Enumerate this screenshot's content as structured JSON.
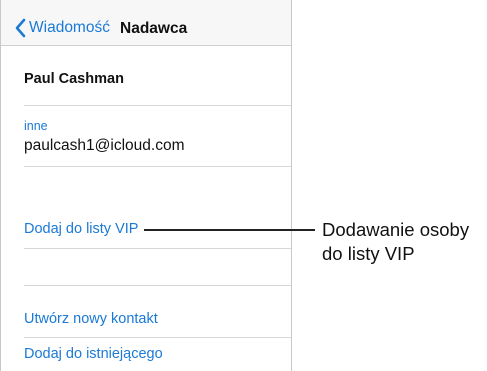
{
  "navbar": {
    "back_label": "Wiadomość",
    "title": "Nadawca"
  },
  "contact": {
    "name": "Paul Cashman",
    "email_label": "inne",
    "email": "paulcash1@icloud.com"
  },
  "actions": {
    "add_vip": "Dodaj do listy VIP",
    "create_contact": "Utwórz nowy kontakt",
    "add_existing": "Dodaj do istniejącego"
  },
  "callout": {
    "line1": "Dodawanie osoby",
    "line2": "do listy VIP"
  },
  "colors": {
    "accent": "#1a7ad6",
    "navbar_bg": "#f7f7f7",
    "separator": "#d8d8dc"
  },
  "icons": {
    "back": "chevron-left-icon"
  }
}
